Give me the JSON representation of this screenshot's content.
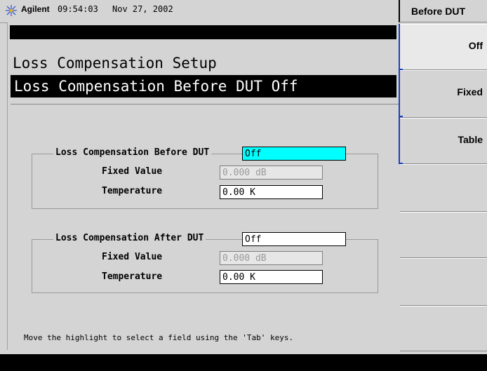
{
  "header": {
    "brand": "Agilent",
    "time": "09:54:03",
    "date": "Nov 27, 2002"
  },
  "screen": {
    "setup_title": "Loss Compensation Setup",
    "title_bar": "Loss Compensation Before DUT Off"
  },
  "before_dut": {
    "legend": "Loss Compensation Before DUT",
    "value": "Off",
    "fixed_label": "Fixed Value",
    "fixed_value": "0.000 dB",
    "temp_label": "Temperature",
    "temp_value": "0.00 K"
  },
  "after_dut": {
    "legend": "Loss Compensation After DUT",
    "value": "Off",
    "fixed_label": "Fixed Value",
    "fixed_value": "0.000 dB",
    "temp_label": "Temperature",
    "temp_value": "0.00 K"
  },
  "hint": "Move the highlight to select a field using the 'Tab' keys.",
  "softkeys": {
    "title": "Before DUT",
    "items": [
      {
        "label": "Off"
      },
      {
        "label": "Fixed"
      },
      {
        "label": "Table"
      },
      {
        "label": ""
      },
      {
        "label": ""
      },
      {
        "label": ""
      },
      {
        "label": ""
      }
    ]
  },
  "colors": {
    "highlight": "#00ffff",
    "bracket": "#1a3fbf"
  }
}
